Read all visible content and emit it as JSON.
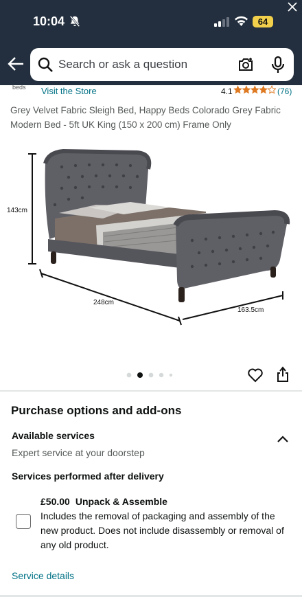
{
  "status_bar": {
    "time": "10:04",
    "battery": "64"
  },
  "search": {
    "placeholder": "Search or ask a question"
  },
  "store": {
    "brand_logo": "beds",
    "link": "Visit the Store",
    "rating": "4.1",
    "rating_value": 4.1,
    "review_count": "(76)"
  },
  "product": {
    "title": "Grey Velvet Fabric Sleigh Bed, Happy Beds Colorado Grey Fabric Modern Bed - 5ft UK King (150 x 200 cm) Frame Only",
    "dimensions": {
      "height": "143cm",
      "length": "248cm",
      "width": "163.5cm"
    },
    "image_index": 2,
    "image_count": 5
  },
  "purchase": {
    "heading": "Purchase options and add-ons",
    "available_services": "Available services",
    "available_sub": "Expert service at your doorstep",
    "after_delivery": "Services performed after delivery",
    "service": {
      "price": "£50.00",
      "name": "Unpack & Assemble",
      "description": "Includes the removal of packaging and assembly of the new product. Does not include disassembly or removal of any old product.",
      "checked": false
    },
    "details_link": "Service details"
  },
  "colors": {
    "header": "#232f3e",
    "link": "#007185",
    "star": "#de7921",
    "bed_fabric": "#5f5f66"
  },
  "icons": [
    "bell-slash-icon",
    "close-icon",
    "signal-icon",
    "wifi-icon",
    "back-arrow-icon",
    "search-icon",
    "camera-icon",
    "mic-icon",
    "star-icon",
    "heart-icon",
    "share-icon",
    "chevron-up-icon"
  ]
}
